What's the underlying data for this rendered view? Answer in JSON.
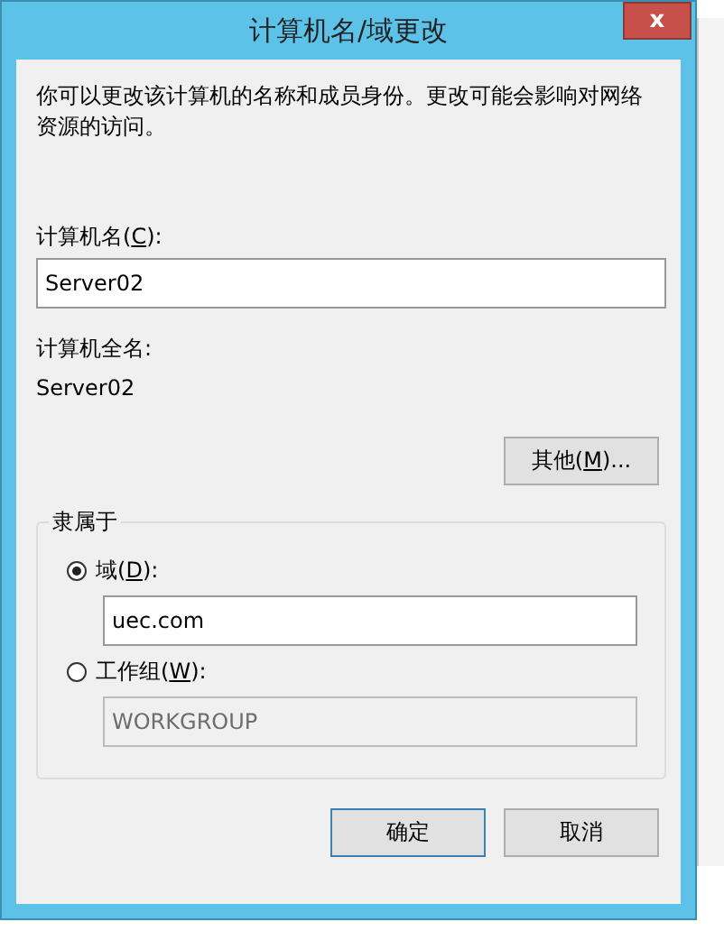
{
  "window": {
    "title": "计算机名/域更改",
    "close": "x"
  },
  "description": "你可以更改该计算机的名称和成员身份。更改可能会影响对网络资源的访问。",
  "computer_name": {
    "label": {
      "before": "计算机名(",
      "key": "C",
      "after": "):"
    },
    "value": "Server02"
  },
  "full_name": {
    "label": "计算机全名:",
    "value": "Server02"
  },
  "more_button": {
    "before": "其他(",
    "key": "M",
    "after": ")..."
  },
  "member_of": {
    "title": "隶属于",
    "options": [
      {
        "label": {
          "before": "域(",
          "key": "D",
          "after": "):"
        },
        "selected": true,
        "value": "uec.com",
        "disabled": false
      },
      {
        "label": {
          "before": "工作组(",
          "key": "W",
          "after": "):"
        },
        "selected": false,
        "value": "WORKGROUP",
        "disabled": true
      }
    ]
  },
  "buttons": [
    "确定",
    "取消"
  ]
}
